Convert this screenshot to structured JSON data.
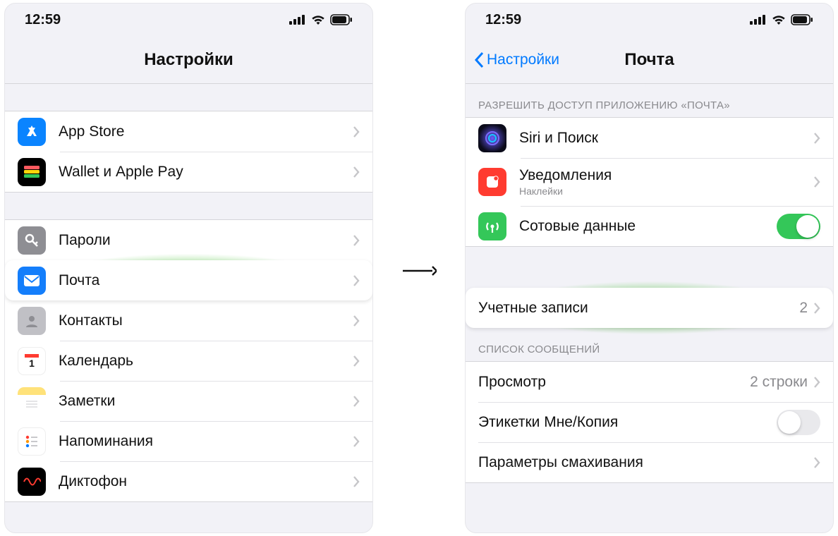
{
  "status": {
    "time": "12:59"
  },
  "left": {
    "title": "Настройки",
    "group1": [
      {
        "label": "App Store",
        "icon": "appstore"
      },
      {
        "label": "Wallet и Apple Pay",
        "icon": "wallet"
      }
    ],
    "group2": [
      {
        "label": "Пароли",
        "icon": "passwords"
      },
      {
        "label": "Почта",
        "icon": "mail",
        "highlight": true
      },
      {
        "label": "Контакты",
        "icon": "contacts"
      },
      {
        "label": "Календарь",
        "icon": "calendar"
      },
      {
        "label": "Заметки",
        "icon": "notes"
      },
      {
        "label": "Напоминания",
        "icon": "reminders"
      },
      {
        "label": "Диктофон",
        "icon": "voice"
      }
    ]
  },
  "right": {
    "back": "Настройки",
    "title": "Почта",
    "section1_header": "РАЗРЕШИТЬ ДОСТУП ПРИЛОЖЕНИЮ «ПОЧТА»",
    "sec1": {
      "siri": "Siri и Поиск",
      "notif": "Уведомления",
      "notif_sub": "Наклейки",
      "cell": "Сотовые данные"
    },
    "accounts": {
      "label": "Учетные записи",
      "value": "2"
    },
    "section3_header": "СПИСОК СООБЩЕНИЙ",
    "sec3": {
      "preview": "Просмотр",
      "preview_val": "2 строки",
      "labels": "Этикетки Мне/Копия",
      "swipe": "Параметры смахивания"
    }
  }
}
